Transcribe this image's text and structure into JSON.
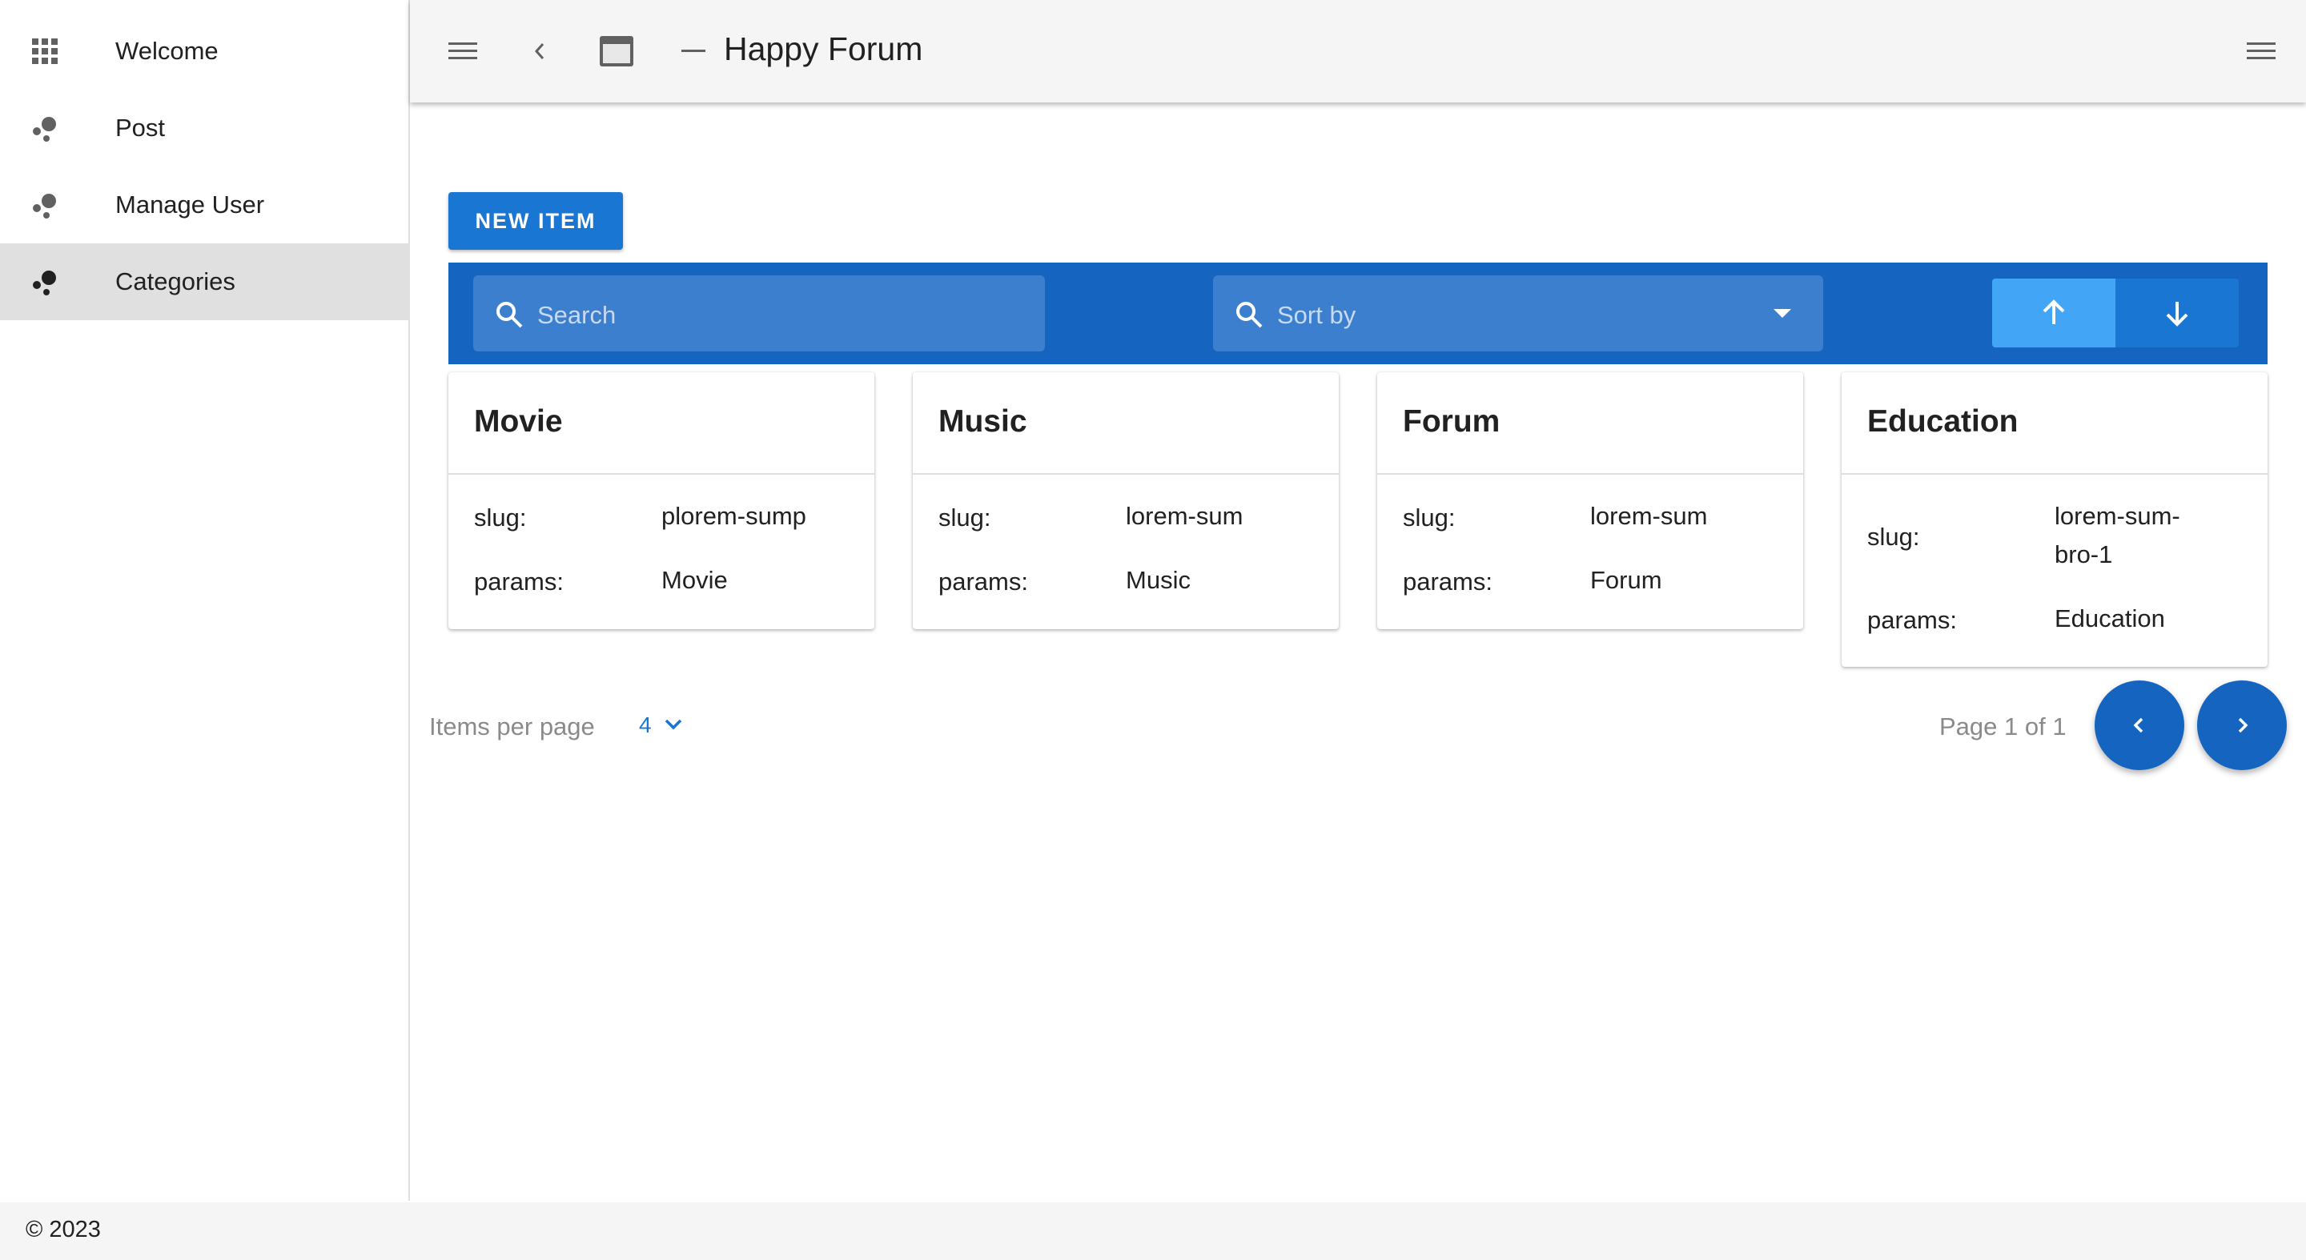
{
  "sidebar": {
    "items": [
      {
        "label": "Welcome",
        "icon": "apps-grid-icon"
      },
      {
        "label": "Post",
        "icon": "bubble-chart-icon"
      },
      {
        "label": "Manage User",
        "icon": "bubble-chart-icon"
      },
      {
        "label": "Categories",
        "icon": "bubble-chart-icon",
        "active": true
      }
    ]
  },
  "appbar": {
    "title": "Happy Forum",
    "icons": [
      "menu-icon",
      "chevron-left-icon",
      "window-icon",
      "minimize-icon",
      "menu-icon"
    ]
  },
  "main": {
    "new_item_label": "NEW ITEM",
    "search_placeholder": "Search",
    "sort_placeholder": "Sort by",
    "cards": [
      {
        "title": "Movie",
        "slug_label": "slug:",
        "slug": "plorem-sump",
        "params_label": "params:",
        "params": "Movie"
      },
      {
        "title": "Music",
        "slug_label": "slug:",
        "slug": "lorem-sum",
        "params_label": "params:",
        "params": "Music"
      },
      {
        "title": "Forum",
        "slug_label": "slug:",
        "slug": "lorem-sum",
        "params_label": "params:",
        "params": "Forum"
      },
      {
        "title": "Education",
        "slug_label": "slug:",
        "slug": "lorem-sum-bro-1",
        "params_label": "params:",
        "params": "Education"
      }
    ],
    "pagination": {
      "items_per_page_label": "Items per page",
      "items_per_page": "4",
      "page_info": "Page 1 of 1"
    }
  },
  "footer": {
    "copyright": "© 2023"
  },
  "colors": {
    "primary": "#1976d2",
    "toolbar": "#1565c0",
    "sort_active": "#42a5f5",
    "active_nav": "#e0e0e0"
  }
}
